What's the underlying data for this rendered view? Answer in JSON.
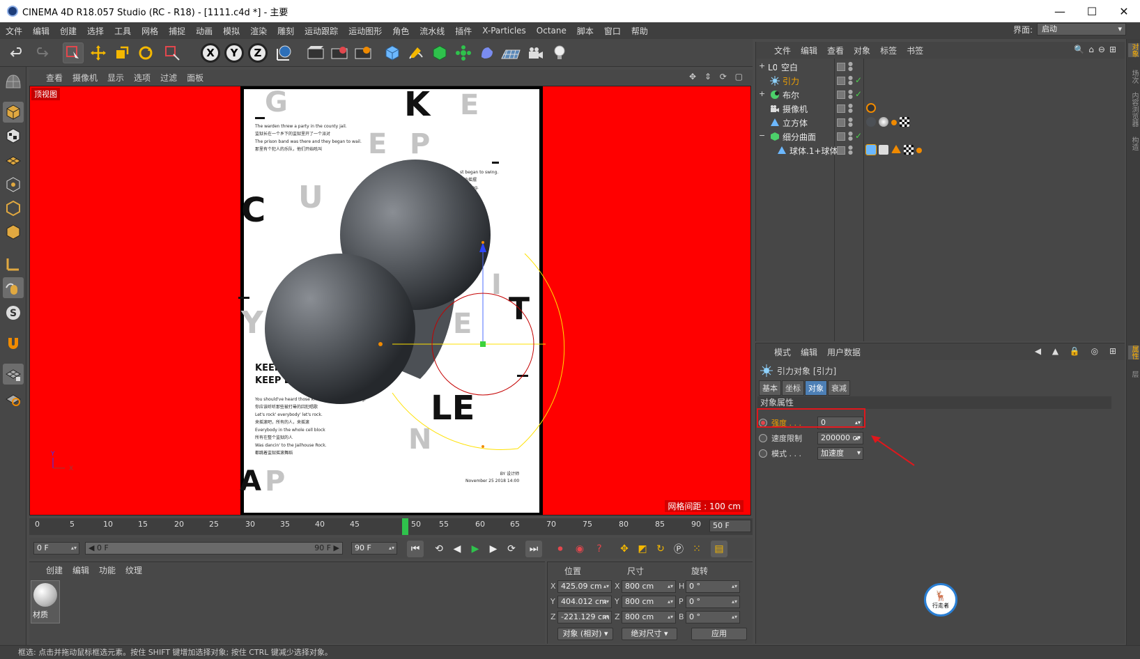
{
  "window": {
    "title": "CINEMA 4D R18.057 Studio (RC - R18) - [1111.c4d *] - 主要",
    "minimize": "—",
    "maximize": "☐",
    "close": "✕"
  },
  "menubar": {
    "items": [
      "文件",
      "编辑",
      "创建",
      "选择",
      "工具",
      "网格",
      "捕捉",
      "动画",
      "模拟",
      "渲染",
      "雕刻",
      "运动跟踪",
      "运动图形",
      "角色",
      "流水线",
      "插件",
      "X-Particles",
      "Octane",
      "脚本",
      "窗口",
      "帮助"
    ],
    "layout_label": "界面:",
    "layout_value": "启动"
  },
  "toolbar": {
    "axis_x": "X",
    "axis_y": "Y",
    "axis_z": "Z"
  },
  "viewport": {
    "menu": [
      "查看",
      "摄像机",
      "显示",
      "选项",
      "过滤",
      "面板"
    ],
    "label": "顶视图",
    "grid_info": "网格间距 : 100 cm",
    "axis_y": "Y",
    "axis_x": "X"
  },
  "poster": {
    "letters_dark": [
      "K",
      "C",
      "LE",
      "T"
    ],
    "letters_light": [
      "G",
      "E",
      "E",
      "P",
      "U",
      "Y",
      "E",
      "N",
      "P",
      "I",
      "A"
    ],
    "lines_top": [
      "The warden threw a party in the county jail.",
      "监狱长在一个乡下的监狱里开了一个派对",
      "The prison band was there and they began to wail.",
      "那里有个犯人的乐队，他们开始吼叫"
    ],
    "lines_right": [
      "st began to swing.",
      "开始摇摆",
      "nds sing.",
      "唱"
    ],
    "keep1": "KEEP",
    "keep2": "KEEP LE",
    "lines_bottom": [
      "You should've heard those knocked out jailbirds sing.",
      "你应该听听那些被打晕的囚犯唱歌",
      "Let's rock' everybody' let's rock.",
      "来摇滚吧，所有的人，来摇滚",
      "Everybody in the whole cell block",
      "所有在整个监狱的人",
      "Was dancin' to the Jailhouse Rock.",
      "都跳着监狱摇滚舞蹈"
    ],
    "footer1": "BY 设计师",
    "footer2": "November 25 2018 14:00"
  },
  "timeline": {
    "ticks": [
      "0",
      "5",
      "10",
      "15",
      "20",
      "25",
      "30",
      "35",
      "40",
      "45",
      "50",
      "55",
      "60",
      "65",
      "70",
      "75",
      "80",
      "85",
      "90"
    ],
    "end_frame": "50 F",
    "current_frame": 50
  },
  "transport": {
    "start": "0 F",
    "range_start": "◀ 0 F",
    "range_end": "90 F ▶",
    "end": "90 F"
  },
  "materials": {
    "menu": [
      "创建",
      "编辑",
      "功能",
      "纹理"
    ],
    "items": [
      {
        "name": "材质"
      }
    ]
  },
  "coordinates": {
    "headers": {
      "position": "位置",
      "size": "尺寸",
      "rotation": "旋转"
    },
    "rows": [
      {
        "axis": "X",
        "pos": "425.09 cm",
        "size_axis": "X",
        "size": "800 cm",
        "rot_axis": "H",
        "rot": "0 °"
      },
      {
        "axis": "Y",
        "pos": "404.012 cm",
        "size_axis": "Y",
        "size": "800 cm",
        "rot_axis": "P",
        "rot": "0 °"
      },
      {
        "axis": "Z",
        "pos": "-221.129 cm",
        "size_axis": "Z",
        "size": "800 cm",
        "rot_axis": "B",
        "rot": "0 °"
      }
    ],
    "mode": "对象 (相对)",
    "size_mode": "绝对尺寸",
    "apply": "应用"
  },
  "status": "框选: 点击并拖动鼠标框选元素。按住 SHIFT 键增加选择对象; 按住 CTRL 键减少选择对象。",
  "object_manager": {
    "menu": [
      "文件",
      "编辑",
      "查看",
      "对象",
      "标签",
      "书签"
    ],
    "objects": [
      {
        "name": "空白",
        "icon_color": "#e8e8e8",
        "expand": "+",
        "check": ""
      },
      {
        "name": "引力",
        "icon_color": "#8fd3ff",
        "expand": "",
        "check": "✓",
        "highlight": true
      },
      {
        "name": "布尔",
        "icon_color": "#4cd06a",
        "expand": "+",
        "check": "✓"
      },
      {
        "name": "摄像机",
        "icon_color": "#cfcfcf",
        "expand": "",
        "check": ""
      },
      {
        "name": "立方体",
        "icon_color": "#6cb8ff",
        "expand": "",
        "check": ""
      },
      {
        "name": "细分曲面",
        "icon_color": "#4cd06a",
        "expand": "−",
        "check": "✓"
      },
      {
        "name": "球体.1+球体",
        "icon_color": "#6cb8ff",
        "expand": "",
        "check": ""
      }
    ]
  },
  "attribute_manager": {
    "menu": [
      "模式",
      "编辑",
      "用户数据"
    ],
    "title": "引力对象 [引力]",
    "tabs": [
      "基本",
      "坐标",
      "对象",
      "衰减"
    ],
    "active_tab": "对象",
    "section": "对象属性",
    "props": [
      {
        "label": "强度 . . .",
        "value": "0",
        "highlight": true
      },
      {
        "label": "速度限制",
        "value": "200000 cr"
      },
      {
        "label": "模式 . . .",
        "value": "加速度"
      }
    ]
  },
  "right_tabs": [
    "对象",
    "场次",
    "内容浏览器",
    "构造",
    "属性",
    "层"
  ],
  "watermark": {
    "line1": "🦌",
    "line2": "行走者"
  }
}
